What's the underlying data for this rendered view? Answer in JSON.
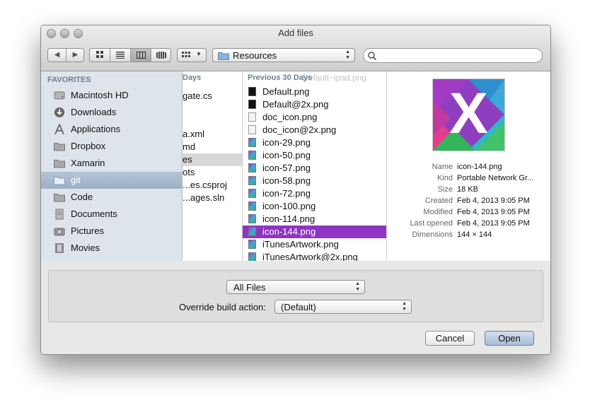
{
  "window": {
    "title": "Add files"
  },
  "toolbar": {
    "back_glyph": "◀",
    "forward_glyph": "▶",
    "location": "Resources",
    "arrange_icon": "grid-arrange-icon",
    "search": {
      "placeholder": ""
    }
  },
  "sidebar": {
    "heading": "FAVORITES",
    "items": [
      {
        "label": "Macintosh HD",
        "icon": "hard-drive-icon"
      },
      {
        "label": "Downloads",
        "icon": "downloads-icon"
      },
      {
        "label": "Applications",
        "icon": "applications-icon"
      },
      {
        "label": "Dropbox",
        "icon": "folder-icon"
      },
      {
        "label": "Xamarin",
        "icon": "folder-icon"
      },
      {
        "label": "git",
        "icon": "folder-icon",
        "selected": true
      },
      {
        "label": "Code",
        "icon": "folder-icon"
      },
      {
        "label": "Documents",
        "icon": "documents-icon"
      },
      {
        "label": "Pictures",
        "icon": "camera-icon"
      },
      {
        "label": "Movies",
        "icon": "film-icon"
      }
    ]
  },
  "column1": {
    "header": "Days",
    "rows": [
      "gate.cs",
      "",
      "",
      "a.xml",
      "md",
      "es",
      "ots",
      "...es.csproj",
      "...ages.sln"
    ]
  },
  "column2": {
    "header": "Previous 30 Days",
    "ghost_text": "Default~ipad.png",
    "rows": [
      {
        "name": "Default.png",
        "icon": "black"
      },
      {
        "name": "Default@2x.png",
        "icon": "black"
      },
      {
        "name": "doc_icon.png",
        "icon": "doc"
      },
      {
        "name": "doc_icon@2x.png",
        "icon": "doc"
      },
      {
        "name": "icon-29.png",
        "icon": "image"
      },
      {
        "name": "icon-50.png",
        "icon": "image"
      },
      {
        "name": "icon-57.png",
        "icon": "image"
      },
      {
        "name": "icon-58.png",
        "icon": "image"
      },
      {
        "name": "icon-72.png",
        "icon": "image"
      },
      {
        "name": "icon-100.png",
        "icon": "image"
      },
      {
        "name": "icon-114.png",
        "icon": "image"
      },
      {
        "name": "icon-144.png",
        "icon": "image",
        "selected": true
      },
      {
        "name": "iTunesArtwork.png",
        "icon": "image"
      },
      {
        "name": "iTunesArtwork@2x.png",
        "icon": "image"
      }
    ]
  },
  "preview": {
    "thumb_letter": "X",
    "meta": [
      {
        "key": "Name",
        "value": "icon-144.png"
      },
      {
        "key": "Kind",
        "value": "Portable Network Gr..."
      },
      {
        "key": "Size",
        "value": "18 KB"
      },
      {
        "key": "Created",
        "value": "Feb 4, 2013 9:05 PM"
      },
      {
        "key": "Modified",
        "value": "Feb 4, 2013 9:05 PM"
      },
      {
        "key": "Last opened",
        "value": "Feb 4, 2013 9:05 PM"
      },
      {
        "key": "Dimensions",
        "value": "144 × 144"
      }
    ]
  },
  "options": {
    "filter_value": "All Files",
    "build_action_label": "Override build action:",
    "build_action_value": "(Default)"
  },
  "buttons": {
    "cancel": "Cancel",
    "open": "Open"
  },
  "colors": {
    "selection": "#8e35c4",
    "sidebar": "#dde4eb"
  }
}
